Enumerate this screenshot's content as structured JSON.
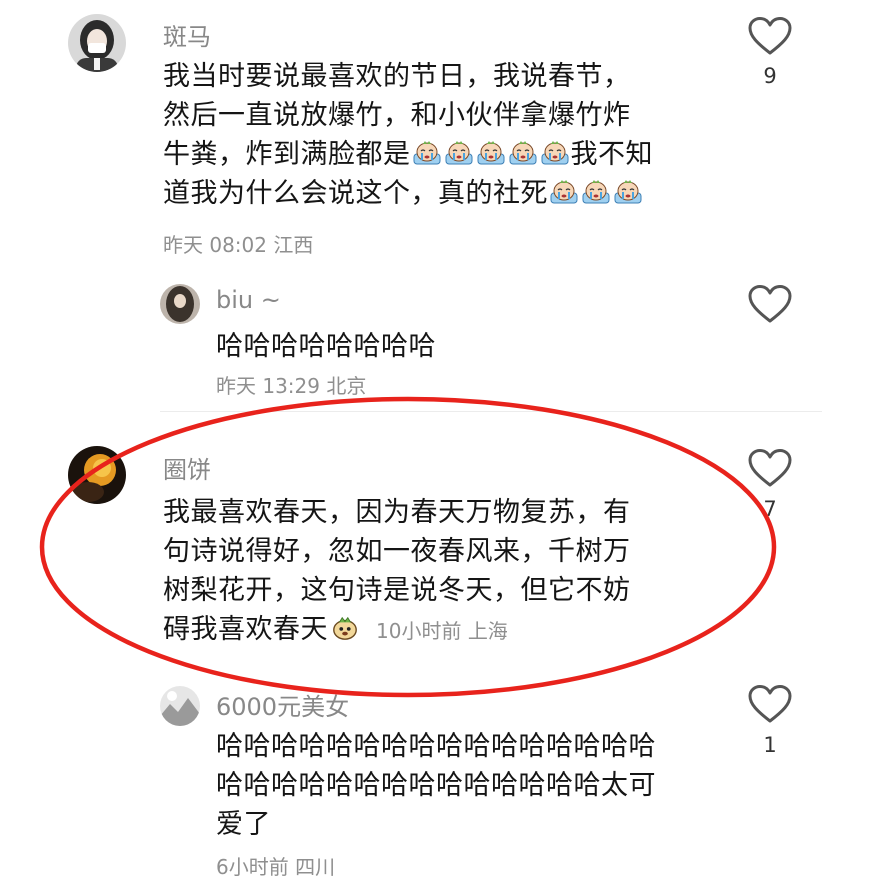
{
  "comments": [
    {
      "username": "斑马",
      "lines": [
        "我当时要说最喜欢的节日，我说春节，",
        "然后一直说放爆竹，和小伙伴拿爆竹炸",
        "牛粪，炸到满脸都是",
        "我不知",
        "道我为什么会说这个，真的社死"
      ],
      "time": "昨天 08:02",
      "location": "江西",
      "likes": "9",
      "avatar_icon": "girl-avatar",
      "reactions": [
        "crying-emoji",
        "crying-emoji",
        "crying-emoji",
        "crying-emoji",
        "crying-emoji",
        "crying-emoji",
        "crying-emoji",
        "crying-emoji"
      ]
    },
    {
      "username": "biu ~",
      "lines": [
        "哈哈哈哈哈哈哈哈"
      ],
      "time": "昨天 13:29",
      "location": "北京",
      "likes": "",
      "avatar_icon": "dark-hair-avatar"
    },
    {
      "username": "圈饼",
      "lines": [
        "我最喜欢春天，因为春天万物复苏，有",
        "句诗说得好，忽如一夜春风来，千树万",
        "树梨花开，这句诗是说冬天，但它不妨",
        "碍我喜欢春天"
      ],
      "time": "10小时前",
      "location": "上海",
      "likes": "7",
      "avatar_icon": "orange-light-avatar",
      "reactions": [
        "dog-emoji"
      ]
    },
    {
      "username": "6000元美女",
      "lines": [
        "哈哈哈哈哈哈哈哈哈哈哈哈哈哈哈哈",
        "哈哈哈哈哈哈哈哈哈哈哈哈哈哈太可",
        "爱了"
      ],
      "time": "6小时前",
      "location": "四川",
      "likes": "1",
      "avatar_icon": "snowy-avatar"
    }
  ],
  "colors": {
    "highlight_ellipse": "#e8231c",
    "username": "#888888",
    "meta": "#8f8f8f",
    "text": "#151515"
  },
  "icons": {
    "like": "heart-outline-icon"
  }
}
